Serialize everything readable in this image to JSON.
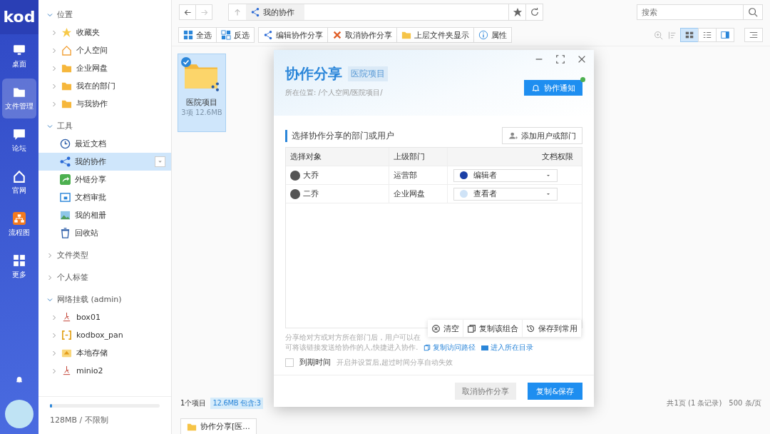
{
  "rail": {
    "logo": "kod",
    "items": [
      {
        "label": "桌面",
        "selected": false
      },
      {
        "label": "文件管理",
        "selected": true
      },
      {
        "label": "论坛",
        "selected": false
      },
      {
        "label": "官网",
        "selected": false
      },
      {
        "label": "流程图",
        "selected": false
      },
      {
        "label": "更多",
        "selected": false
      }
    ]
  },
  "tree": {
    "sections": [
      {
        "label": "位置",
        "expanded": true,
        "children": [
          {
            "label": "收藏夹",
            "expanded": false,
            "selected": false
          },
          {
            "label": "个人空间",
            "expanded": false,
            "selected": false
          },
          {
            "label": "企业网盘",
            "expanded": false,
            "selected": false
          },
          {
            "label": "我在的部门",
            "expanded": false,
            "selected": false
          },
          {
            "label": "与我协作",
            "expanded": false,
            "selected": false
          }
        ]
      },
      {
        "label": "工具",
        "expanded": true,
        "children": [
          {
            "label": "最近文档",
            "selected": false
          },
          {
            "label": "我的协作",
            "selected": true
          },
          {
            "label": "外链分享",
            "selected": false
          },
          {
            "label": "文档审批",
            "selected": false
          },
          {
            "label": "我的相册",
            "selected": false
          },
          {
            "label": "回收站",
            "selected": false
          }
        ]
      },
      {
        "label": "文件类型",
        "expanded": false
      },
      {
        "label": "个人标签",
        "expanded": false
      },
      {
        "label": "网络挂载 (admin)",
        "expanded": true,
        "children": [
          {
            "label": "box01",
            "expanded": false,
            "selected": false
          },
          {
            "label": "kodbox_pan",
            "expanded": false,
            "selected": false
          },
          {
            "label": "本地存储",
            "expanded": false,
            "selected": false
          },
          {
            "label": "minio2",
            "expanded": false,
            "selected": false
          }
        ]
      }
    ],
    "storage": {
      "text": "128MB / 不限制",
      "level": 0.02
    }
  },
  "address_bar": {
    "crumb": "我的协作",
    "search_placeholder": "搜索"
  },
  "toolbar": {
    "buttons": [
      "全选",
      "反选",
      "编辑协作分享",
      "取消协作分享",
      "上层文件夹显示",
      "属性"
    ],
    "views": [
      {
        "selected": true
      },
      {
        "selected": false
      },
      {
        "selected": false
      }
    ]
  },
  "files": [
    {
      "name": "医院项目",
      "meta": "3项 12.6MB",
      "selected": true
    }
  ],
  "status_bar": {
    "count": "1个项目",
    "size": "12.6MB 包含:3",
    "pages": "共1页 (1 条记录)",
    "per_page": "500 条/页"
  },
  "taskbar": {
    "tab": "协作分享[医..."
  },
  "dialog": {
    "title": "协作分享",
    "tag": "医院项目",
    "path": "所在位置: /个人空间/医院项目/",
    "notify_button": "协作通知",
    "section_title": "选择协作分享的部门或用户",
    "add_button": "添加用户或部门",
    "table": {
      "columns": [
        "选择对象",
        "上级部门",
        "文档权限"
      ],
      "rows": [
        {
          "name": "大乔",
          "dept": "运营部",
          "role": "编辑者",
          "color": "#1a3fa6"
        },
        {
          "name": "二乔",
          "dept": "企业网盘",
          "role": "查看者",
          "color": "#cfe3f7"
        }
      ]
    },
    "hint_lines": [
      "分享给对方或对方所在部门后，用户可以在",
      "可将该链接发送给协作的人,快捷进入协作."
    ],
    "links": [
      "复制访问路径",
      "进入所在目录"
    ],
    "float_actions": [
      "清空",
      "复制该组合",
      "保存到常用"
    ],
    "expire": {
      "label": "到期时间",
      "checked": false,
      "hint": "开启并设置后,超过时间分享自动失效"
    },
    "buttons": [
      {
        "label": "取消协作分享",
        "kind": "secondary"
      },
      {
        "label": "复制&保存",
        "kind": "primary"
      }
    ]
  }
}
